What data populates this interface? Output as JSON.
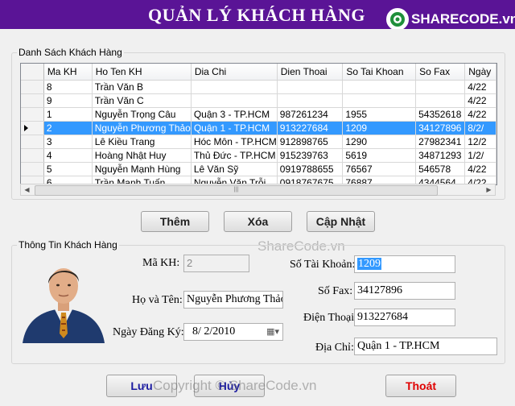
{
  "header": {
    "title": "QUẢN LÝ KHÁCH HÀNG",
    "logo_text": "SHARECODE.vn"
  },
  "list_group": {
    "legend": "Danh Sách Khách Hàng"
  },
  "grid": {
    "columns": [
      "Ma KH",
      "Ho Ten KH",
      "Dia Chi",
      "Dien Thoai",
      "So Tai Khoan",
      "So Fax",
      "Ngày"
    ],
    "rows": [
      {
        "ma": "8",
        "ten": "Trần Văn B",
        "diachi": "",
        "dt": "",
        "tk": "",
        "fax": "",
        "ngay": "4/22"
      },
      {
        "ma": "9",
        "ten": "Trần Văn C",
        "diachi": "",
        "dt": "",
        "tk": "",
        "fax": "",
        "ngay": "4/22"
      },
      {
        "ma": "1",
        "ten": "Nguyễn Trọng Câu",
        "diachi": "Quận 3 - TP.HCM",
        "dt": "987261234",
        "tk": "1955",
        "fax": "54352618",
        "ngay": "4/22"
      },
      {
        "ma": "2",
        "ten": "Nguyễn Phương Thảo",
        "diachi": "Quận 1 - TP.HCM",
        "dt": "913227684",
        "tk": "1209",
        "fax": "34127896",
        "ngay": "8/2/"
      },
      {
        "ma": "3",
        "ten": "Lê Kiều Trang",
        "diachi": "Hóc Môn - TP.HCM",
        "dt": "912898765",
        "tk": "1290",
        "fax": "27982341",
        "ngay": "12/2"
      },
      {
        "ma": "4",
        "ten": "Hoàng Nhật Huy",
        "diachi": "Thủ Đức - TP.HCM",
        "dt": "915239763",
        "tk": "5619",
        "fax": "34871293",
        "ngay": "1/2/"
      },
      {
        "ma": "5",
        "ten": "Nguyễn Mạnh Hùng",
        "diachi": "Lê Văn Sỹ",
        "dt": "0919788655",
        "tk": "76567",
        "fax": "546578",
        "ngay": "4/22"
      },
      {
        "ma": "6",
        "ten": "Trần Mạnh Tuấn",
        "diachi": "Nguyễn Văn Trỗi",
        "dt": "0918767675",
        "tk": "76887",
        "fax": "4344564",
        "ngay": "4/22"
      }
    ],
    "selected_row": 3
  },
  "actions": {
    "them": "Thêm",
    "xoa": "Xóa",
    "capnhat": "Cập Nhật"
  },
  "detail_group": {
    "legend": "Thông Tin Khách Hàng"
  },
  "form": {
    "makh_label": "Mã KH:",
    "makh_value": "2",
    "hoten_label": "Họ và Tên:",
    "hoten_value": "Nguyễn Phương Thảo",
    "ngay_label": "Ngày Đăng Ký:",
    "ngay_value": "8/ 2/2010",
    "sotk_label": "Số Tài Khoản:",
    "sotk_value": "1209",
    "sofax_label": "Số Fax:",
    "sofax_value": "34127896",
    "dienthoai_label": "Điện Thoại:",
    "dienthoai_value": "913227684",
    "diachi_label": "Địa Chỉ:",
    "diachi_value": "Quận 1 - TP.HCM"
  },
  "bottom": {
    "luu": "Lưu",
    "huy": "Hủy",
    "thoat": "Thoát"
  },
  "watermarks": {
    "center": "ShareCode.vn",
    "bottom": "Copyright © ShareCode.vn"
  },
  "colors": {
    "title_bar": "#5a1496",
    "selection": "#3399ff",
    "exit_text": "#e00000",
    "save_text": "#1a1aa0"
  }
}
